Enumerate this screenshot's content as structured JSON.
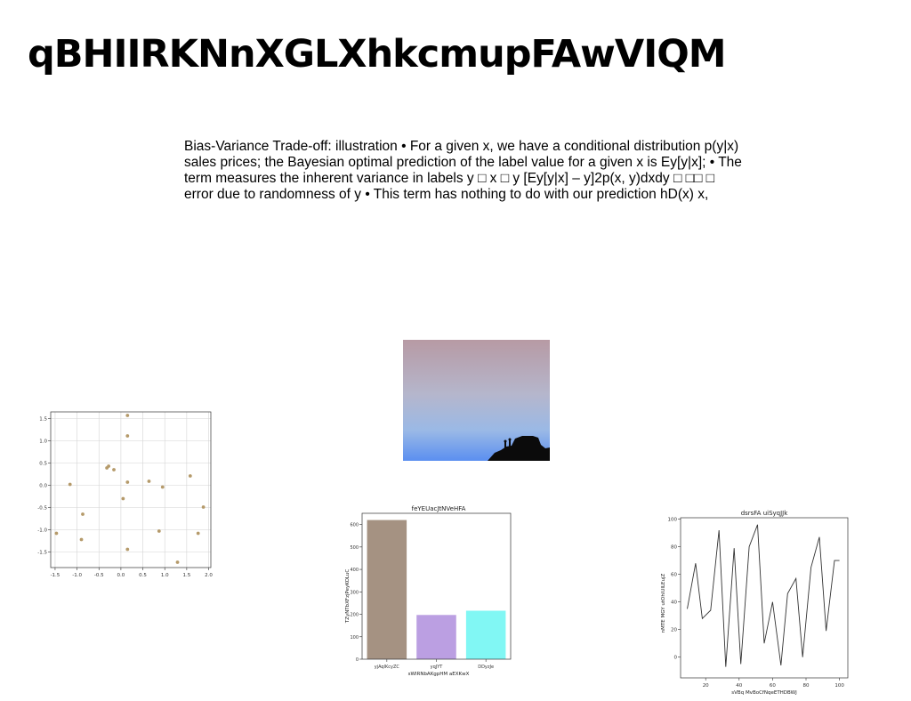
{
  "slide": {
    "title": "qBHIIRKNnXGLXhkcmupFAwVIQM",
    "paragraph_lines": [
      "Bias-Variance Trade-off: illustration • For a given x, we have a conditional distribution p(y|x)",
      "sales prices; the Bayesian optimal prediction of the label value for a given x is Ey[y|x]; • The",
      "term measures the inherent variance in labels y □ x □ y [Ey[y|x] – y]2p(x, y)dxdy □ □□ □",
      "error due to randomness of y • This term has nothing to do with our prediction hD(x) x,"
    ]
  },
  "image": {
    "description": "sky-silhouette-photo"
  },
  "chart_data": [
    {
      "type": "scatter",
      "title": "",
      "xlabel": "",
      "ylabel": "",
      "xlim": [
        -1.6,
        2.05
      ],
      "ylim": [
        -1.85,
        1.65
      ],
      "xticks": [
        "-1.5",
        "-1.0",
        "-0.5",
        "0.0",
        "0.5",
        "1.0",
        "1.5",
        "2.0"
      ],
      "yticks": [
        "1.5",
        "1.0",
        "0.5",
        "0.0",
        "-0.5",
        "-1.0",
        "-1.5"
      ],
      "grid": true,
      "color": "#b59a6a",
      "points": [
        [
          -1.47,
          -1.08
        ],
        [
          -1.16,
          0.02
        ],
        [
          -0.9,
          -1.22
        ],
        [
          -0.87,
          -0.65
        ],
        [
          -0.32,
          0.39
        ],
        [
          -0.28,
          0.43
        ],
        [
          -0.16,
          0.35
        ],
        [
          0.05,
          -0.3
        ],
        [
          0.15,
          1.57
        ],
        [
          0.15,
          1.11
        ],
        [
          0.15,
          0.07
        ],
        [
          0.15,
          -1.44
        ],
        [
          0.64,
          0.09
        ],
        [
          0.87,
          -1.03
        ],
        [
          0.95,
          -0.04
        ],
        [
          1.29,
          -1.73
        ],
        [
          1.58,
          0.21
        ],
        [
          1.76,
          -1.08
        ],
        [
          1.88,
          -0.49
        ]
      ]
    },
    {
      "type": "bar",
      "title": "feYEUacJtNVeHFA",
      "xlabel": "sWIRNbAKgpHM aEXKwX",
      "ylabel": "TZyNTbXFzjPeyKOLuC",
      "categories": [
        "yjAqlKcyZC",
        "yqJYT",
        "DDyzJe"
      ],
      "values": [
        620,
        197,
        216
      ],
      "colors": [
        "#a59282",
        "#bb9fe2",
        "#81f7f4"
      ],
      "ylim": [
        0,
        650
      ],
      "yticks": [
        "0",
        "100",
        "200",
        "300",
        "400",
        "500",
        "600"
      ]
    },
    {
      "type": "line",
      "title": "dsrsFA uiSyqJJk",
      "xlabel": "sVBq MvBoCfNqeETHDBWJ",
      "ylabel": "nMTE MGY utOhlUILEujZ",
      "xlim": [
        5,
        105
      ],
      "ylim": [
        -15,
        101
      ],
      "xticks": [
        "20",
        "40",
        "60",
        "80",
        "100"
      ],
      "yticks": [
        "100",
        "80",
        "60",
        "40",
        "20",
        "0"
      ],
      "color": "#333333",
      "x": [
        9,
        14,
        18,
        23,
        28,
        32,
        37,
        41,
        46,
        51,
        55,
        60,
        65,
        69,
        74,
        78,
        83,
        88,
        92,
        97,
        100
      ],
      "y": [
        35,
        68,
        28,
        34,
        92,
        -7,
        79,
        -5,
        80,
        96,
        10,
        40,
        -6,
        46,
        57,
        0,
        65,
        87,
        19,
        70,
        70
      ]
    }
  ]
}
